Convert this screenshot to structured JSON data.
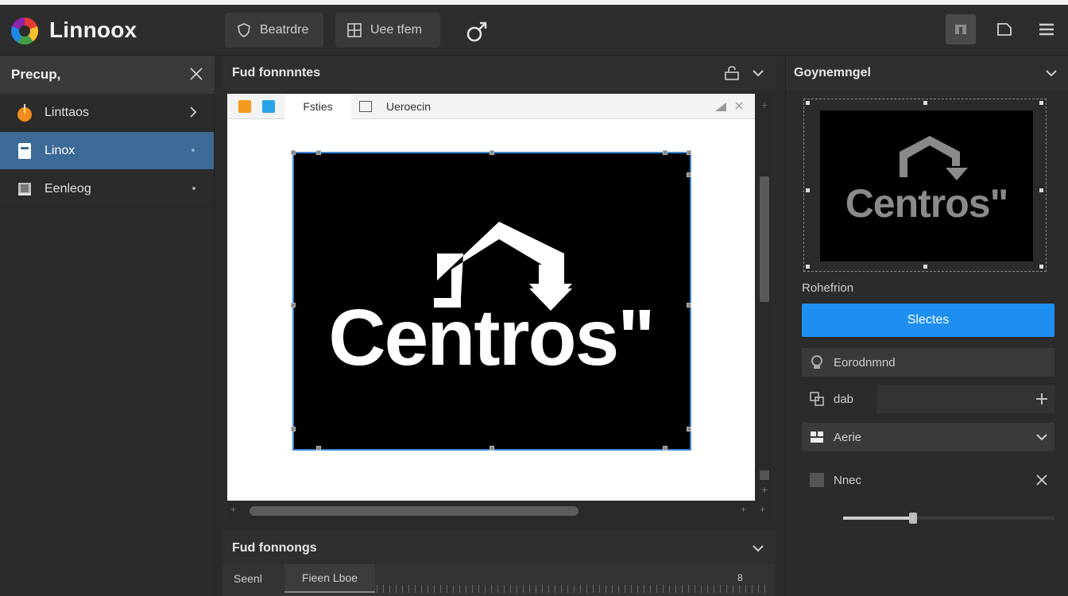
{
  "app": {
    "title": "Linnoox",
    "colors": {
      "background": "#2b2b2b",
      "accent": "#1e8ff0",
      "active_item": "#3d6a97"
    }
  },
  "toolbar": {
    "buttons": [
      {
        "label": "Beatrdre",
        "icon": "shield-icon"
      },
      {
        "label": "Uee tfem",
        "icon": "grid-icon"
      }
    ],
    "extra_icon": "male-symbol-icon",
    "right_icons": [
      "layout-icon",
      "page-icon",
      "menu-icon"
    ]
  },
  "sidebar": {
    "header": "Precup,",
    "items": [
      {
        "label": "Linttaos",
        "icon": "flame-icon"
      },
      {
        "label": "Linox",
        "icon": "document-icon"
      },
      {
        "label": "Eenleog",
        "icon": "book-icon"
      }
    ]
  },
  "editor": {
    "header": "Fud fonnnntes",
    "tabs": [
      {
        "label": "Fsties"
      },
      {
        "label": "Ueroecin"
      }
    ],
    "canvas_text": "Centros\"",
    "bottom_header": "Fud fonnongs",
    "bottom_tabs": [
      {
        "label": "Seenl"
      },
      {
        "label": "Fieen Lboe"
      }
    ],
    "ruler_marker": "8"
  },
  "properties": {
    "header": "Goynemngel",
    "preview_text": "Centros\"",
    "section_label": "Rohefrion",
    "primary_button": "Slectes",
    "rows": [
      {
        "label": "Eorodnmnd",
        "icon": "stamp-icon"
      },
      {
        "label": "dab",
        "icon": "copy-icon"
      },
      {
        "label": "Aerie",
        "icon": "flag-icon"
      },
      {
        "label": "Nnec",
        "icon": "square-icon"
      }
    ],
    "slider_value": 0.33
  }
}
